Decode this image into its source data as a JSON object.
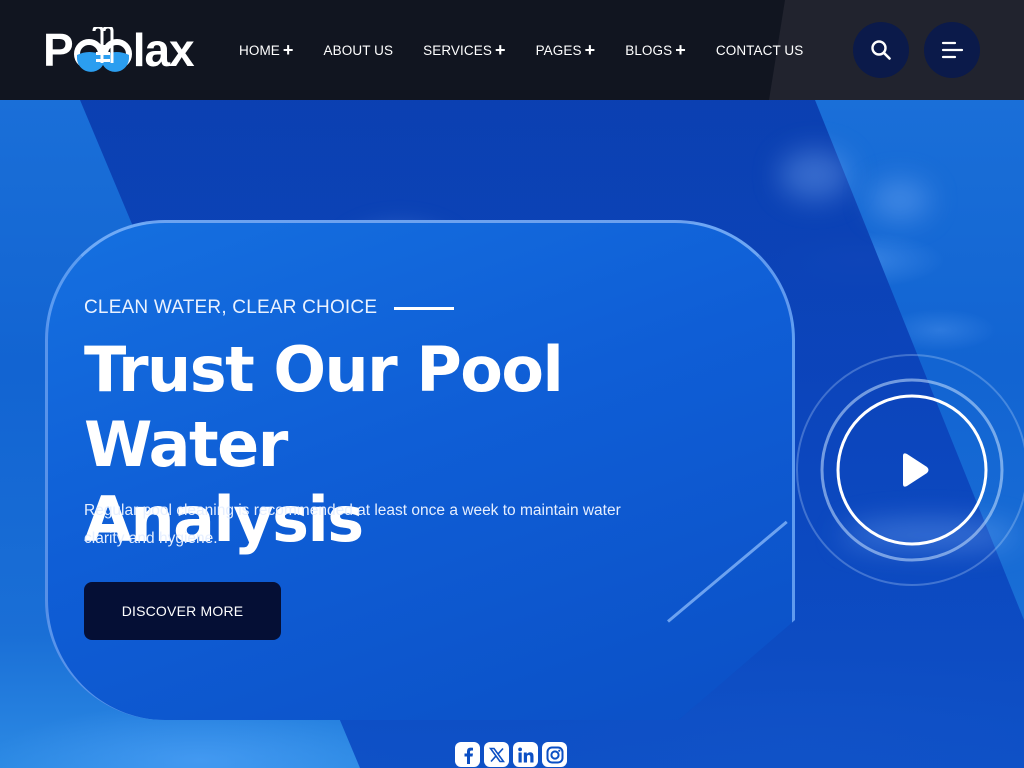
{
  "brand": {
    "logo_text_start": "P",
    "logo_text_end": "lax",
    "logo_full": "Poolax",
    "colors": {
      "header_bg": "#111520",
      "accent_dark": "#050f35",
      "circle_btn": "#0b1a4a",
      "hero_blue": "#1264d2",
      "logo_water": "#2b9ef0"
    }
  },
  "nav": {
    "items": [
      {
        "label": "HOME",
        "has_submenu": true,
        "icon": "plus-icon"
      },
      {
        "label": "ABOUT US",
        "has_submenu": false
      },
      {
        "label": "SERVICES",
        "has_submenu": true,
        "icon": "plus-icon"
      },
      {
        "label": "PAGES",
        "has_submenu": true,
        "icon": "plus-icon"
      },
      {
        "label": "BLOGS",
        "has_submenu": true,
        "icon": "plus-icon"
      },
      {
        "label": "CONTACT US",
        "has_submenu": false
      }
    ],
    "plus_glyph": "+",
    "search_icon": "search-icon",
    "menu_icon": "hamburger-menu-icon"
  },
  "hero": {
    "eyebrow": "CLEAN WATER, CLEAR CHOICE",
    "headline_line1": "Trust Our Pool Water",
    "headline_line2": "Analysis",
    "description": "Regular pool cleaning is recommended at least once a week to maintain water clarity and hygiene.",
    "cta_label": "DISCOVER MORE",
    "play_icon": "play-icon"
  },
  "social": [
    {
      "name": "facebook",
      "icon": "facebook-icon",
      "glyph": "f"
    },
    {
      "name": "x",
      "icon": "x-twitter-icon",
      "glyph": "X"
    },
    {
      "name": "linkedin",
      "icon": "linkedin-icon",
      "glyph": "in"
    },
    {
      "name": "instagram",
      "icon": "instagram-icon",
      "glyph": ""
    }
  ]
}
